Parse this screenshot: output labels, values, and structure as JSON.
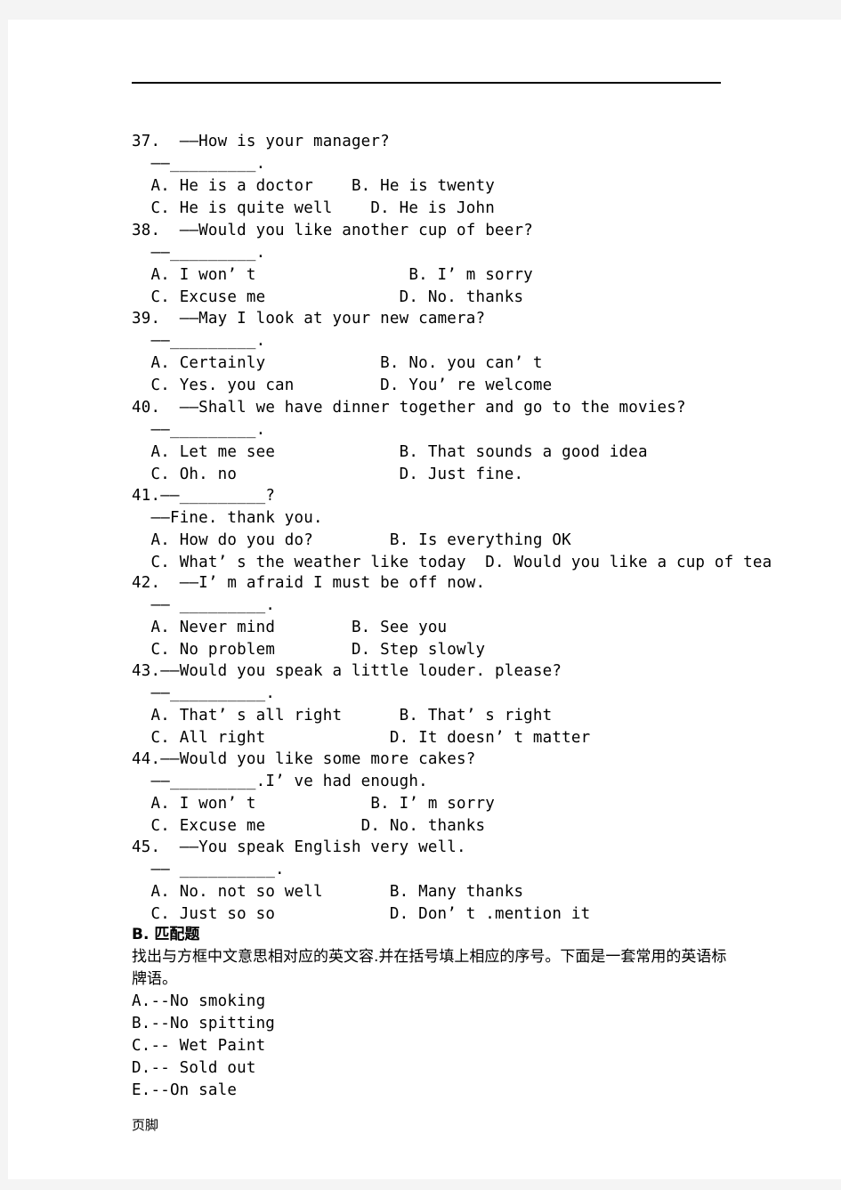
{
  "page": {
    "footer_label": "页脚",
    "header_rule": true,
    "background_color": "#f4f4f4",
    "sheet_color": "#ffffff",
    "text_color": "#000000"
  },
  "questions": [
    {
      "number": "37.",
      "prompt": "——How is your manager?",
      "answer_line": "——_________.",
      "options_row1": "A. He is a doctor    B. He is twenty",
      "options_row2": "C. He is quite well    D. He is John"
    },
    {
      "number": "38.",
      "prompt": "——Would you like another cup of beer?",
      "answer_line": "——_________.",
      "options_row1": "A. I won’ t                B. I’ m sorry",
      "options_row2": "C. Excuse me              D. No. thanks"
    },
    {
      "number": "39.",
      "prompt": "——May I look at your new camera?",
      "answer_line": "——_________.",
      "options_row1": "A. Certainly            B. No. you can’ t",
      "options_row2": "C. Yes. you can         D. You’ re welcome"
    },
    {
      "number": "40.",
      "prompt": "——Shall we have dinner together and go to the movies?",
      "answer_line": "——_________.",
      "options_row1": "A. Let me see             B. That sounds a good idea",
      "options_row2": "C. Oh. no                 D. Just fine."
    },
    {
      "number": "41.",
      "prompt": "——_________?",
      "answer_line": "——Fine. thank you.",
      "options_row1": "A. How do you do?        B. Is everything OK",
      "options_row2": "C. What’ s the weather like today  D. Would you like a cup of tea"
    },
    {
      "number": "42.",
      "prompt": "——I’ m afraid I must be off now.",
      "answer_line": "—— _________.",
      "options_row1": "A. Never mind        B. See you",
      "options_row2": "C. No problem        D. Step slowly"
    },
    {
      "number": "43.",
      "prompt": "——Would you speak a little louder. please?",
      "answer_line": "——__________.",
      "options_row1": "A. That’ s all right      B. That’ s right",
      "options_row2": "C. All right             D. It doesn’ t matter"
    },
    {
      "number": "44.",
      "prompt": "——Would you like some more cakes?",
      "answer_line": "——_________.I’ ve had enough.",
      "options_row1": "A. I won’ t            B. I’ m sorry",
      "options_row2": "C. Excuse me          D. No. thanks"
    },
    {
      "number": "45.",
      "prompt": "——You speak English very well.",
      "answer_line": "—— __________.",
      "options_row1": "A. No. not so well       B. Many thanks",
      "options_row2": "C. Just so so            D. Don’ t .mention it"
    }
  ],
  "section_b": {
    "heading": "B. 匹配题",
    "instruction": "找出与方框中文意思相对应的英文容.并在括号填上相应的序号。下面是一套常用的英语标牌语。",
    "items": [
      "A.--No smoking",
      "B.--No spitting",
      "C.-- Wet Paint",
      "D.-- Sold out",
      "E.--On sale"
    ]
  }
}
